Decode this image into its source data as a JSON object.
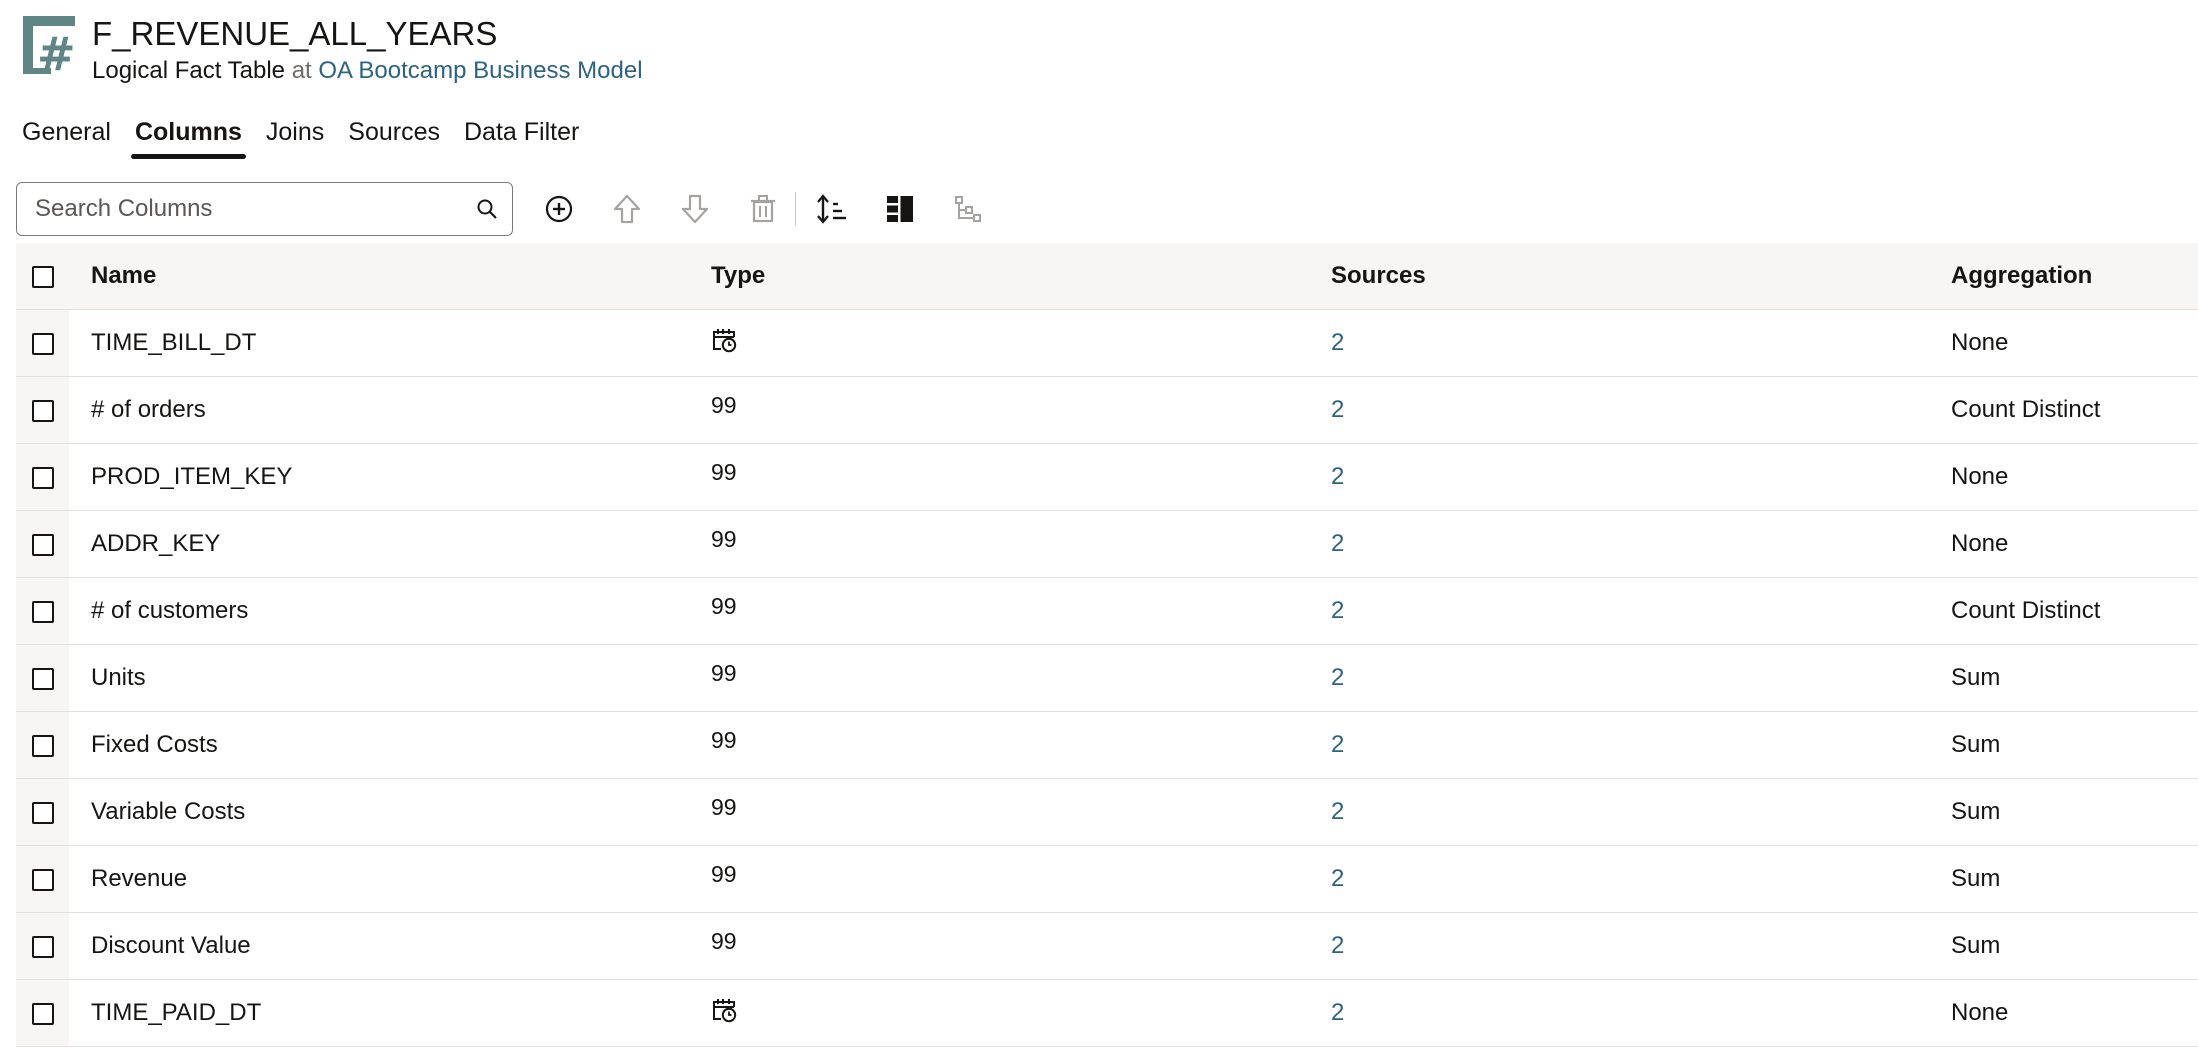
{
  "header": {
    "icon": "logical-fact-table-icon",
    "title": "F_REVENUE_ALL_YEARS",
    "subtitle_type": "Logical Fact Table",
    "subtitle_at": "at",
    "subtitle_link": "OA Bootcamp Business Model"
  },
  "tabs": [
    {
      "label": "General"
    },
    {
      "label": "Columns",
      "active": true
    },
    {
      "label": "Joins"
    },
    {
      "label": "Sources"
    },
    {
      "label": "Data Filter"
    }
  ],
  "toolbar": {
    "search_placeholder": "Search Columns",
    "icons": [
      "search-icon",
      "add-icon",
      "move-up-icon",
      "move-down-icon",
      "delete-icon",
      "sort-icon",
      "column-layout-icon",
      "hierarchy-icon"
    ]
  },
  "table": {
    "headers": {
      "name": "Name",
      "type": "Type",
      "sources": "Sources",
      "aggregation": "Aggregation"
    },
    "rows": [
      {
        "name": "TIME_BILL_DT",
        "type": "datetime",
        "type_label": "",
        "sources": "2",
        "aggregation": "None"
      },
      {
        "name": "# of orders",
        "type": "number",
        "type_label": "99",
        "sources": "2",
        "aggregation": "Count Distinct"
      },
      {
        "name": "PROD_ITEM_KEY",
        "type": "number",
        "type_label": "99",
        "sources": "2",
        "aggregation": "None"
      },
      {
        "name": "ADDR_KEY",
        "type": "number",
        "type_label": "99",
        "sources": "2",
        "aggregation": "None"
      },
      {
        "name": "# of customers",
        "type": "number",
        "type_label": "99",
        "sources": "2",
        "aggregation": "Count Distinct"
      },
      {
        "name": "Units",
        "type": "number",
        "type_label": "99",
        "sources": "2",
        "aggregation": "Sum"
      },
      {
        "name": "Fixed Costs",
        "type": "number",
        "type_label": "99",
        "sources": "2",
        "aggregation": "Sum"
      },
      {
        "name": "Variable Costs",
        "type": "number",
        "type_label": "99",
        "sources": "2",
        "aggregation": "Sum"
      },
      {
        "name": "Revenue",
        "type": "number",
        "type_label": "99",
        "sources": "2",
        "aggregation": "Sum"
      },
      {
        "name": "Discount Value",
        "type": "number",
        "type_label": "99",
        "sources": "2",
        "aggregation": "Sum"
      },
      {
        "name": "TIME_PAID_DT",
        "type": "datetime",
        "type_label": "",
        "sources": "2",
        "aggregation": "None"
      }
    ]
  },
  "colors": {
    "link": "#2d6382",
    "icon_teal": "#5f8587"
  }
}
